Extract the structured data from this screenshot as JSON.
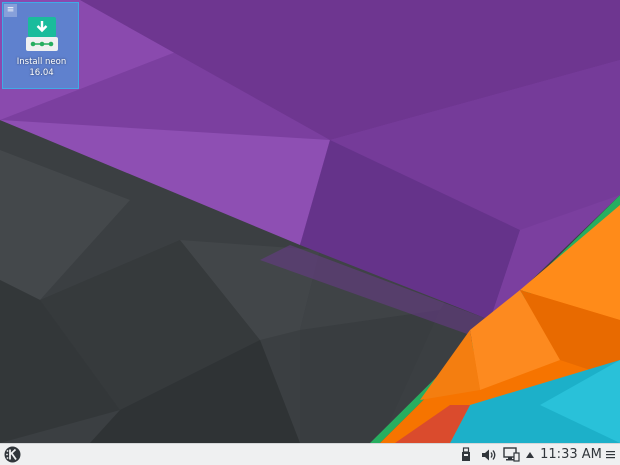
{
  "desktop": {
    "icons": [
      {
        "label_line1": "Install neon",
        "label_line2": "16.04",
        "icon": "download-installer-icon"
      }
    ]
  },
  "panel": {
    "launcher_icon": "kde-logo-icon",
    "tray": {
      "icons": [
        "device-notifier-icon",
        "volume-icon",
        "network-display-icon",
        "expand-tray-arrow-icon"
      ],
      "clock": "11:33 AM"
    },
    "menu_icon": "panel-menu-icon"
  },
  "colors": {
    "purple": "#7b3f9f",
    "dark_gray": "#3a3e41",
    "orange": "#f67400",
    "teal": "#1cb0c9",
    "green": "#27ae60",
    "panel_bg": "#eff0f1",
    "icon_highlight": "#3daee9"
  }
}
